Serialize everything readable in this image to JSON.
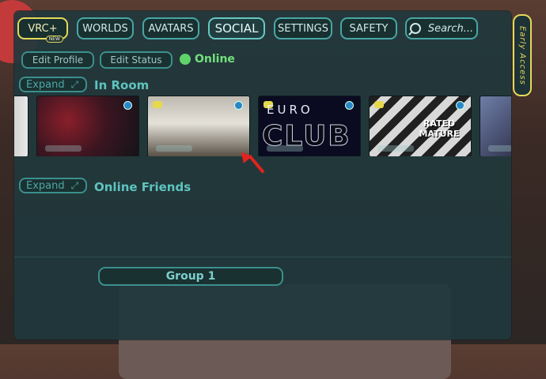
{
  "nav": {
    "vrc_plus": {
      "label": "VRC+",
      "badge": "NEW"
    },
    "worlds": "WORLDS",
    "avatars": "AVATARS",
    "social": "SOCIAL",
    "settings": "SETTINGS",
    "safety": "SAFETY",
    "search": "Search..."
  },
  "side_tab": "Early Access",
  "profile": {
    "edit_profile": "Edit Profile",
    "edit_status": "Edit Status",
    "status": "Online",
    "status_color": "#5fd36a"
  },
  "in_room": {
    "expand": "Expand",
    "title": "In Room",
    "thumbnails": [
      {
        "icon": "avatar-thumbnail",
        "has_dot": false
      },
      {
        "icon": "avatar-thumbnail",
        "has_dot": true
      },
      {
        "icon": "avatar-thumbnail",
        "has_dot": true,
        "highlighted": true
      },
      {
        "icon": "avatar-thumbnail",
        "has_dot": true,
        "text_top": "EURO",
        "text_main": "CLUB"
      },
      {
        "icon": "avatar-thumbnail",
        "has_dot": true,
        "text_main": "RATED MATURE"
      },
      {
        "icon": "avatar-thumbnail",
        "has_dot": false
      }
    ]
  },
  "online_friends": {
    "expand": "Expand",
    "title": "Online Friends"
  },
  "group": {
    "label": "Group 1"
  },
  "colors": {
    "accent": "#47a6a6",
    "vrc_plus": "#e4d95a",
    "online": "#5fd36a",
    "annotation_arrow": "#e0241d"
  }
}
